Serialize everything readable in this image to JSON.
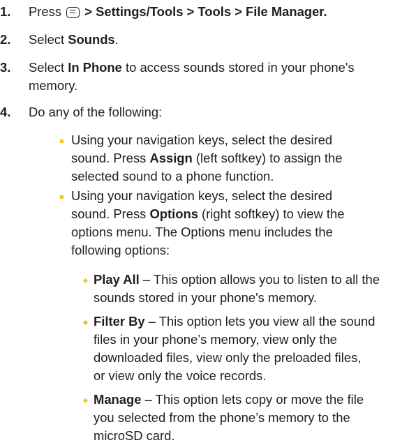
{
  "steps": [
    {
      "num": "1.",
      "pre": "Press",
      "path": " > Settings/Tools > Tools > File Manager."
    },
    {
      "num": "2.",
      "pre": "Select ",
      "bold": "Sounds",
      "post": "."
    },
    {
      "num": "3.",
      "pre": "Select ",
      "bold": "In Phone",
      "post": " to access sounds stored in your phone's",
      "line2": "memory."
    },
    {
      "num": "4.",
      "text": "Do any of the following:"
    }
  ],
  "bullets": [
    {
      "lines": [
        "Using your navigation keys, select the desired"
      ],
      "l2_pre": "sound. Press ",
      "l2_bold": "Assign",
      "l2_post": " (left softkey) to assign the",
      "l3": "selected sound to a phone function."
    },
    {
      "lines": [
        "Using your navigation keys, select the desired"
      ],
      "l2_pre": "sound. Press ",
      "l2_bold": "Options",
      "l2_post": " (right softkey) to view the",
      "l3": "options menu. The Options menu includes the",
      "l4": "following options:"
    }
  ],
  "options": [
    {
      "bold": "Play All",
      "rest": " – This option allows you to listen to all the",
      "more": [
        "sounds stored in your phone's memory."
      ]
    },
    {
      "bold": "Filter By",
      "rest": " – This option lets you view all the sound",
      "more": [
        "files in your phone’s memory, view only the",
        "downloaded files, view only the preloaded files,",
        "or view only the voice records."
      ]
    },
    {
      "bold": "Manage",
      "rest": " – This option lets copy or move the file",
      "more": [
        "you selected from the phone’s memory to the",
        "microSD card."
      ]
    }
  ],
  "icons": {
    "menu_key": "menu-ok-key-icon"
  },
  "colors": {
    "bullet": "#f2c418",
    "text": "#1e1e1e"
  }
}
